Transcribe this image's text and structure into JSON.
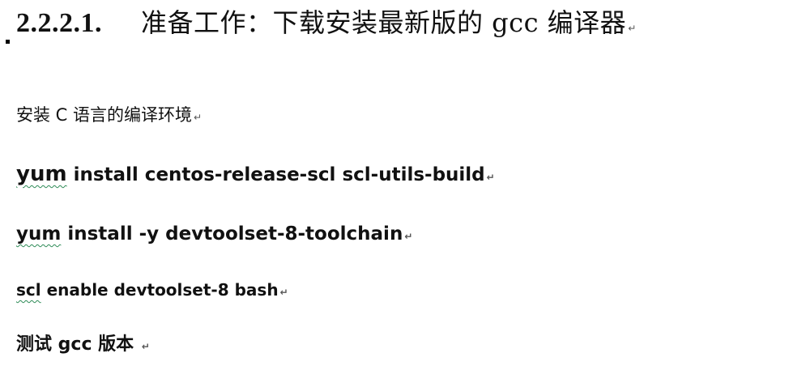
{
  "heading": {
    "number": "2.2.2.1.",
    "text": "准备工作：下载安装最新版的 gcc 编译器"
  },
  "paragraph_mark": "↵",
  "lines": {
    "intro": "安装 C 语言的编译环境",
    "cmd1_first": "yum",
    "cmd1_rest": " install centos-release-scl scl-utils-build",
    "cmd2_first": "yum",
    "cmd2_rest": " install -y devtoolset-8-toolchain",
    "cmd3_first": "scl",
    "cmd3_rest": " enable devtoolset-8  bash",
    "test": "测试 gcc 版本 "
  }
}
